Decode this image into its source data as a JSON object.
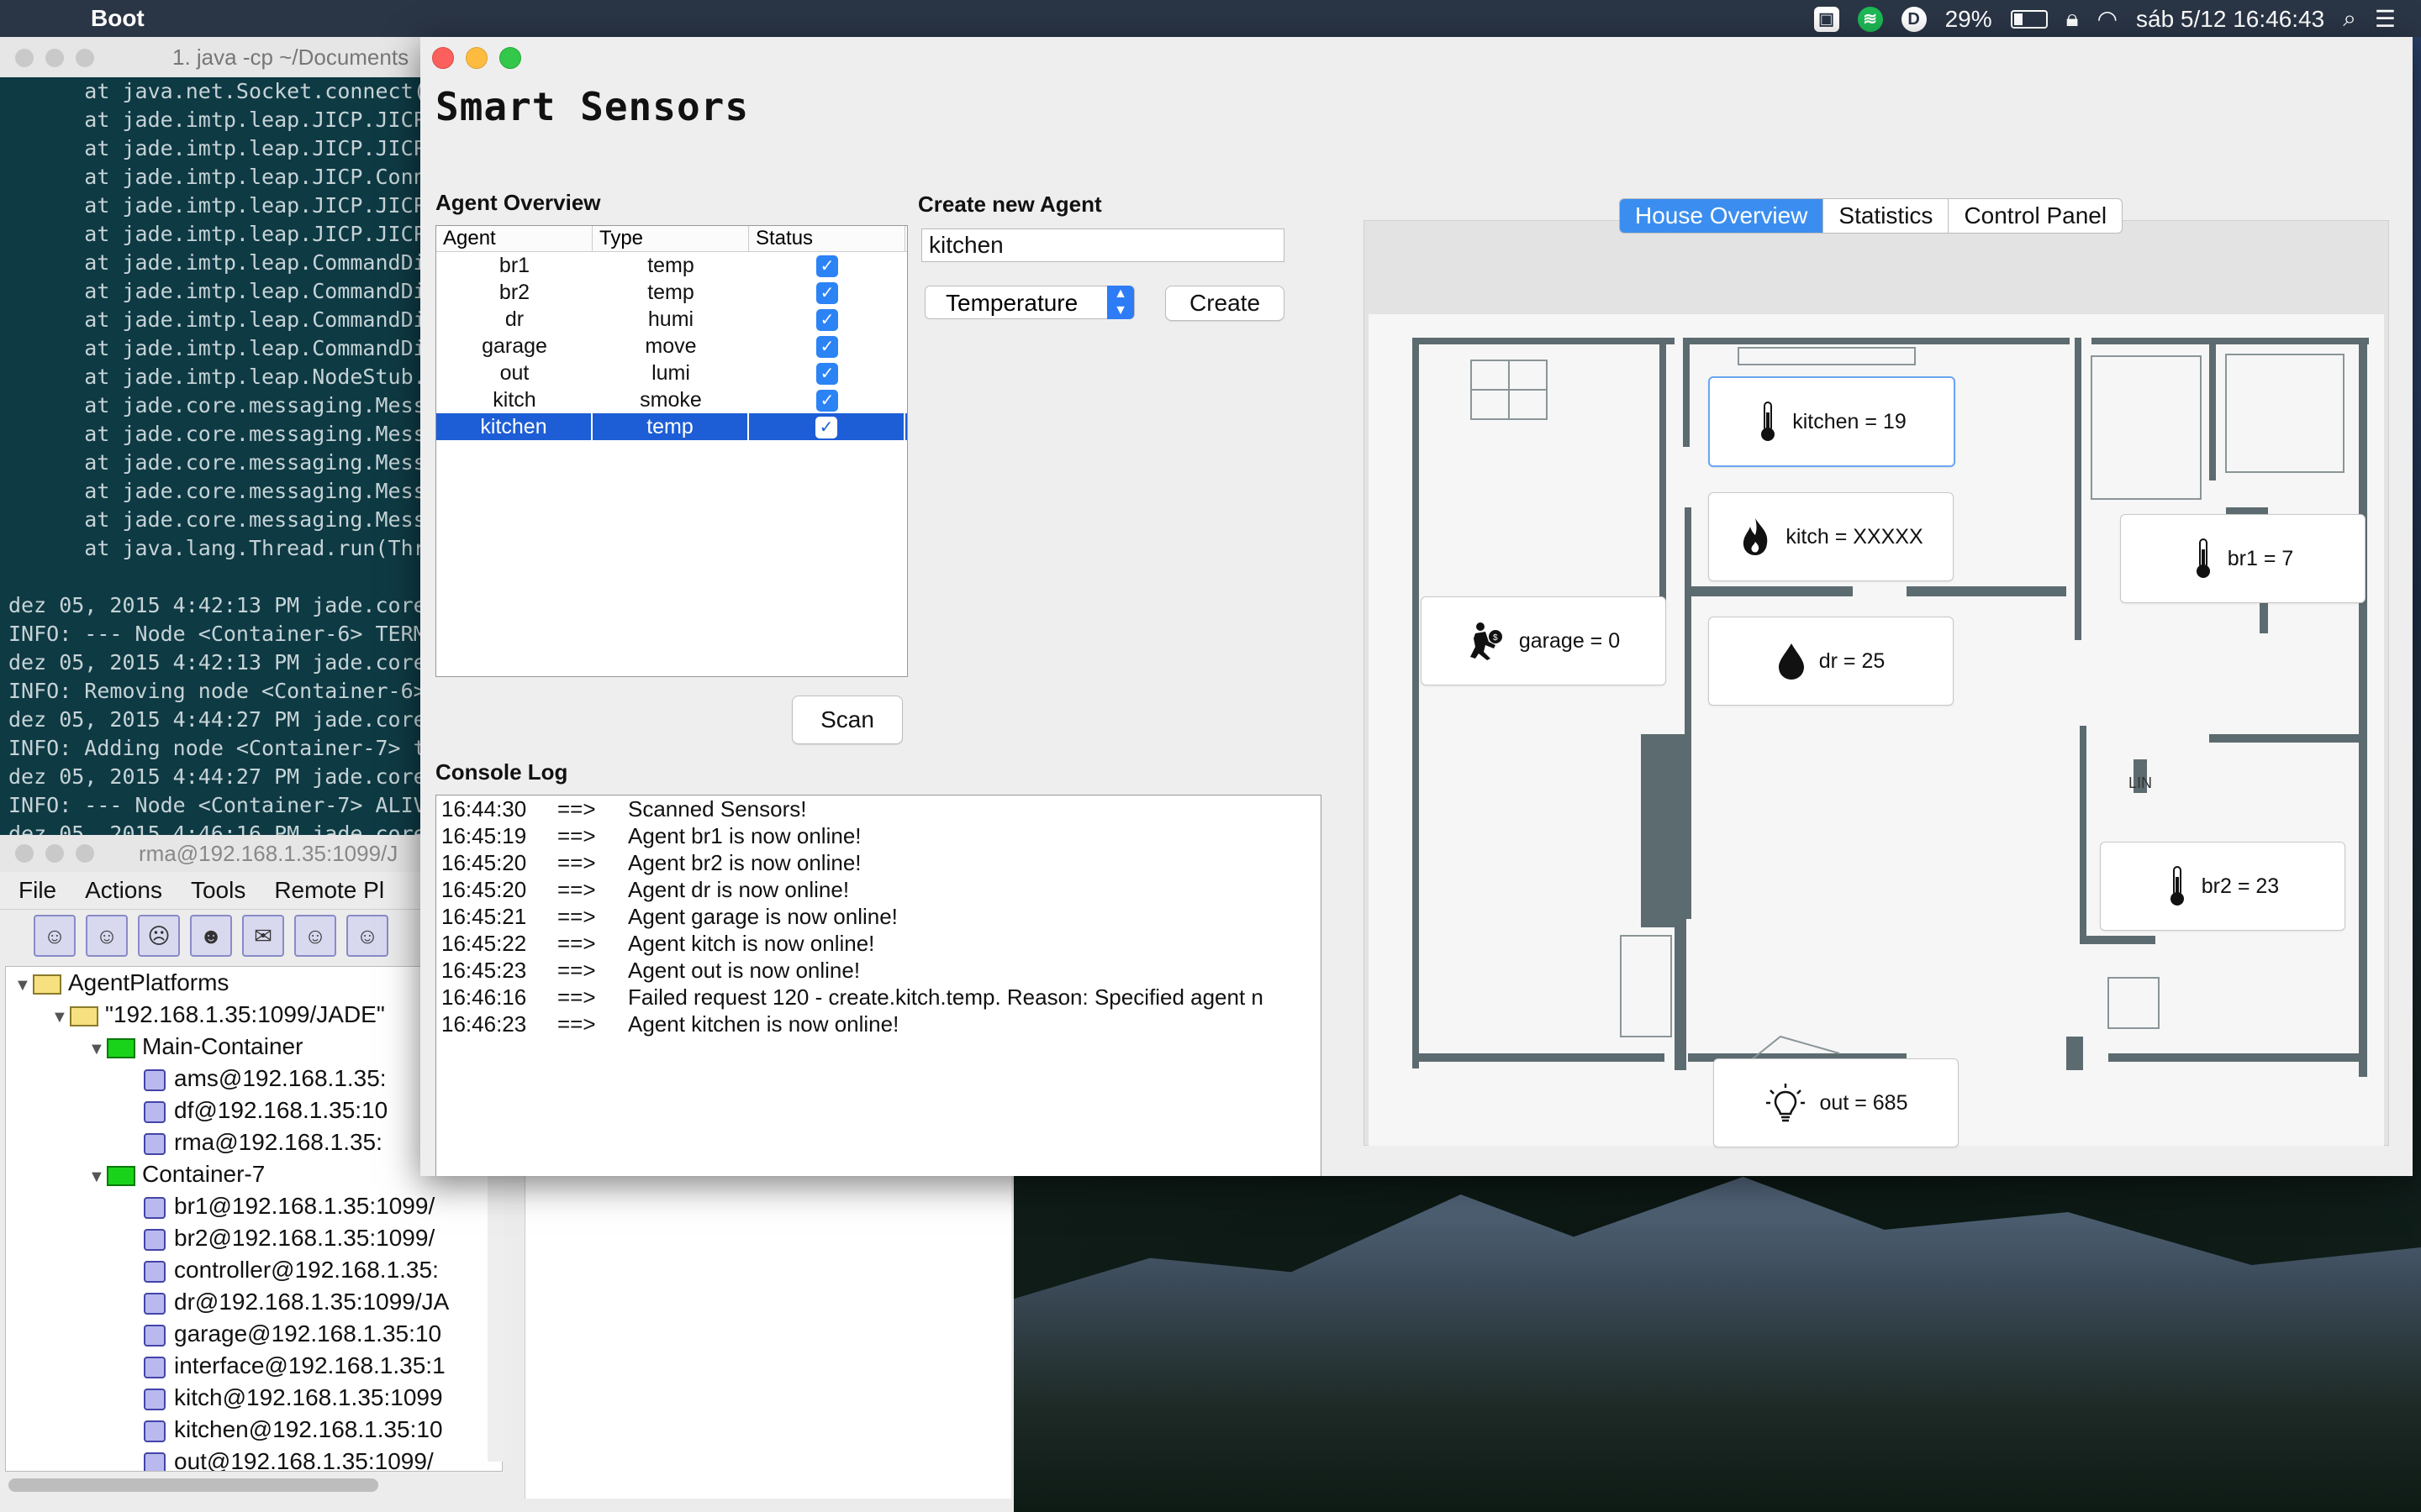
{
  "menubar": {
    "app_name": "Boot",
    "battery": "29%",
    "clock": "sáb 5/12  16:46:43"
  },
  "terminal": {
    "title": "1. java -cp ~/Documents",
    "lines": [
      "      at java.net.Socket.connect(",
      "      at jade.imtp.leap.JICP.JICP",
      "      at jade.imtp.leap.JICP.JICP",
      "      at jade.imtp.leap.JICP.Conn",
      "      at jade.imtp.leap.JICP.JICP",
      "      at jade.imtp.leap.JICP.JICP",
      "      at jade.imtp.leap.CommandDi",
      "      at jade.imtp.leap.CommandDi",
      "      at jade.imtp.leap.CommandDi",
      "      at jade.imtp.leap.CommandDi",
      "      at jade.imtp.leap.NodeStub.",
      "      at jade.core.messaging.Mess",
      "      at jade.core.messaging.Mess",
      "      at jade.core.messaging.Mess",
      "      at jade.core.messaging.Mess",
      "      at jade.core.messaging.Mess",
      "      at java.lang.Thread.run(Thr",
      "",
      "dez 05, 2015 4:42:13 PM jade.core.P",
      "INFO: --- Node <Container-6> TERMIN",
      "dez 05, 2015 4:42:13 PM jade.core.P",
      "INFO: Removing node <Container-6> f",
      "dez 05, 2015 4:44:27 PM jade.core.P",
      "INFO: Adding node <Container-7> to",
      "dez 05, 2015 4:44:27 PM jade.core.P",
      "INFO: --- Node <Container-7> ALIVE",
      "dez 05, 2015 4:46:16 PM jade.core.P"
    ]
  },
  "rma": {
    "title": "rma@192.168.1.35:1099/J",
    "menus": [
      "File",
      "Actions",
      "Tools",
      "Remote Pl"
    ],
    "tree": [
      {
        "label": "AgentPlatforms",
        "indent": 0,
        "kind": "folder",
        "tri": "▼"
      },
      {
        "label": "\"192.168.1.35:1099/JADE\"",
        "indent": 1,
        "kind": "folder",
        "tri": "▼"
      },
      {
        "label": "Main-Container",
        "indent": 2,
        "kind": "green",
        "tri": "▼"
      },
      {
        "label": "ams@192.168.1.35:",
        "indent": 3,
        "kind": "agent",
        "tri": ""
      },
      {
        "label": "df@192.168.1.35:10",
        "indent": 3,
        "kind": "agent",
        "tri": ""
      },
      {
        "label": "rma@192.168.1.35:",
        "indent": 3,
        "kind": "agent",
        "tri": ""
      },
      {
        "label": "Container-7",
        "indent": 2,
        "kind": "green",
        "tri": "▼"
      },
      {
        "label": "br1@192.168.1.35:1099/",
        "indent": 3,
        "kind": "agent",
        "tri": ""
      },
      {
        "label": "br2@192.168.1.35:1099/",
        "indent": 3,
        "kind": "agent",
        "tri": ""
      },
      {
        "label": "controller@192.168.1.35:",
        "indent": 3,
        "kind": "agent",
        "tri": ""
      },
      {
        "label": "dr@192.168.1.35:1099/JA",
        "indent": 3,
        "kind": "agent",
        "tri": ""
      },
      {
        "label": "garage@192.168.1.35:10",
        "indent": 3,
        "kind": "agent",
        "tri": ""
      },
      {
        "label": "interface@192.168.1.35:1",
        "indent": 3,
        "kind": "agent",
        "tri": ""
      },
      {
        "label": "kitch@192.168.1.35:1099",
        "indent": 3,
        "kind": "agent",
        "tri": ""
      },
      {
        "label": "kitchen@192.168.1.35:10",
        "indent": 3,
        "kind": "agent",
        "tri": ""
      },
      {
        "label": "out@192.168.1.35:1099/",
        "indent": 3,
        "kind": "agent",
        "tri": ""
      }
    ]
  },
  "app": {
    "title": "Smart Sensors",
    "agent_overview_label": "Agent Overview",
    "create_label": "Create new Agent",
    "table_headers": [
      "Agent",
      "Type",
      "Status"
    ],
    "agents": [
      {
        "name": "br1",
        "type": "temp",
        "status": true
      },
      {
        "name": "br2",
        "type": "temp",
        "status": true
      },
      {
        "name": "dr",
        "type": "humi",
        "status": true
      },
      {
        "name": "garage",
        "type": "move",
        "status": true
      },
      {
        "name": "out",
        "type": "lumi",
        "status": true
      },
      {
        "name": "kitch",
        "type": "smoke",
        "status": true
      },
      {
        "name": "kitchen",
        "type": "temp",
        "status": true
      }
    ],
    "selected_agent": "kitchen",
    "name_input_value": "kitchen",
    "type_select_value": "Temperature",
    "create_button": "Create",
    "scan_button": "Scan",
    "console_label": "Console Log",
    "console": [
      {
        "time": "16:44:30",
        "arrow": "==>",
        "msg": "Scanned Sensors!"
      },
      {
        "time": "16:45:19",
        "arrow": "==>",
        "msg": "Agent br1 is now online!"
      },
      {
        "time": "16:45:20",
        "arrow": "==>",
        "msg": "Agent br2 is now online!"
      },
      {
        "time": "16:45:20",
        "arrow": "==>",
        "msg": "Agent dr is now online!"
      },
      {
        "time": "16:45:21",
        "arrow": "==>",
        "msg": "Agent garage is now online!"
      },
      {
        "time": "16:45:22",
        "arrow": "==>",
        "msg": "Agent kitch is now online!"
      },
      {
        "time": "16:45:23",
        "arrow": "==>",
        "msg": "Agent out is now online!"
      },
      {
        "time": "16:46:16",
        "arrow": "==>",
        "msg": "Failed request 120 - create.kitch.temp. Reason: Specified agent n"
      },
      {
        "time": "16:46:23",
        "arrow": "==>",
        "msg": "Agent kitchen is now online!"
      }
    ],
    "tabs": [
      "House Overview",
      "Statistics",
      "Control Panel"
    ],
    "active_tab": "House Overview",
    "sensors": {
      "kitchen": {
        "label": "kitchen = 19",
        "icon": "thermometer-icon"
      },
      "kitch": {
        "label": "kitch = XXXXX",
        "icon": "flame-icon"
      },
      "br1": {
        "label": "br1 = 7",
        "icon": "thermometer-icon"
      },
      "garage": {
        "label": "garage = 0",
        "icon": "motion-icon"
      },
      "dr": {
        "label": "dr = 25",
        "icon": "water-drop-icon"
      },
      "br2": {
        "label": "br2 = 23",
        "icon": "thermometer-icon"
      },
      "out": {
        "label": "out = 685",
        "icon": "light-bulb-icon"
      }
    }
  }
}
